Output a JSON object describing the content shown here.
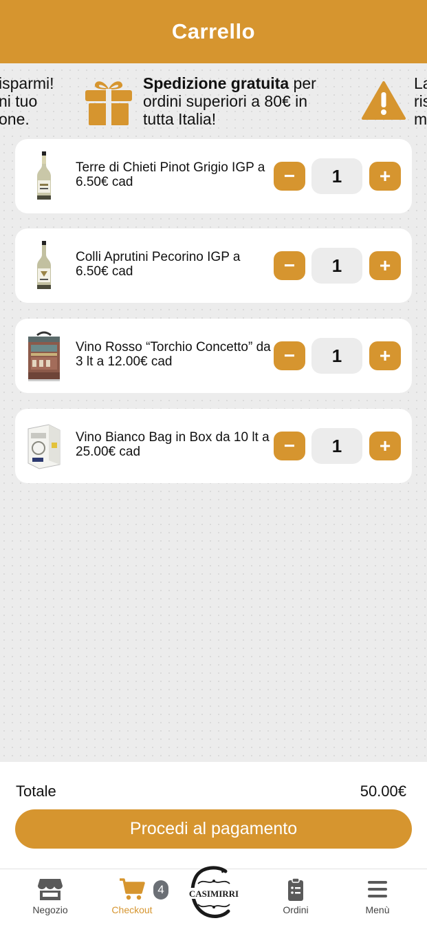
{
  "header": {
    "title": "Carrello"
  },
  "banner": {
    "left_fragment": [
      "isparmi!",
      "ni tuo",
      "one."
    ],
    "promo_bold": "Spedizione gratuita",
    "promo_rest": " per ordini superiori a 80€ in tutta Italia!",
    "right_fragment": [
      "La",
      "ris",
      "m"
    ]
  },
  "cart": {
    "items": [
      {
        "name": "Terre di Chieti Pinot Grigio IGP a 6.50€ cad",
        "qty": "1",
        "thumb": "white-wine-bottle"
      },
      {
        "name": "Colli Aprutini Pecorino IGP a 6.50€ cad",
        "qty": "1",
        "thumb": "white-wine-bottle"
      },
      {
        "name": "Vino Rosso “Torchio Concetto” da 3 lt a 12.00€ cad",
        "qty": "1",
        "thumb": "wine-box"
      },
      {
        "name": "Vino Bianco Bag in Box da 10 lt a 25.00€ cad",
        "qty": "1",
        "thumb": "bag-in-box"
      }
    ],
    "minus_label": "−",
    "plus_label": "+"
  },
  "footer": {
    "total_label": "Totale",
    "total_value": "50.00€",
    "pay_label": "Procedi al pagamento"
  },
  "nav": {
    "items": [
      {
        "label": "Negozio",
        "icon": "store-icon"
      },
      {
        "label": "Checkout",
        "icon": "cart-icon",
        "badge": "4",
        "active": true
      },
      {
        "label": "Ordini",
        "icon": "clipboard-icon"
      },
      {
        "label": "Menù",
        "icon": "hamburger-icon"
      }
    ],
    "logo_text": "CASIMIRRI"
  },
  "colors": {
    "accent": "#d6952f",
    "background": "#ececec",
    "card": "#ffffff",
    "badge": "#6b6f75"
  }
}
